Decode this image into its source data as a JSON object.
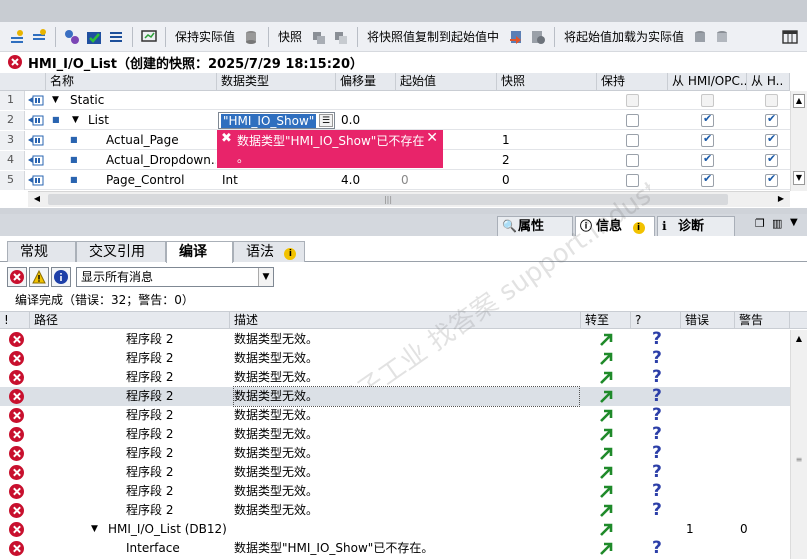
{
  "toolbar": {
    "keep_actual_label": "保持实际值",
    "snapshot_label": "快照",
    "copy_snapshot_label": "将快照值复制到起始值中",
    "load_start_label": "将起始值加载为实际值"
  },
  "block_title": "HMI_I/O_List（创建的快照：2025/7/29 18:15:20）",
  "table": {
    "headers": [
      "名称",
      "数据类型",
      "偏移量",
      "起始值",
      "快照",
      "保持",
      "从 HMI/OPC..",
      "从 H.."
    ],
    "rows": [
      {
        "num": "1",
        "name": "Static",
        "type": "",
        "offset": "",
        "start": "",
        "snapshot": ""
      },
      {
        "num": "2",
        "name": "List",
        "type": "\"HMI_IO_Show\"",
        "offset": "0.0",
        "start": "",
        "snapshot": ""
      },
      {
        "num": "3",
        "name": "Actual_Page",
        "type": "",
        "offset": "",
        "start": "",
        "snapshot": "1"
      },
      {
        "num": "4",
        "name": "Actual_Dropdown...",
        "type": "",
        "offset": "",
        "start": "",
        "snapshot": "2"
      },
      {
        "num": "5",
        "name": "Page_Control",
        "type": "Int",
        "offset": "4.0",
        "start": "0",
        "snapshot": "0"
      }
    ],
    "error_popup": "数据类型\"HMI_IO_Show\"已不存在\n。"
  },
  "inspector": {
    "tab_properties": "属性",
    "tab_info": "信息",
    "tab_diagnostics": "诊断"
  },
  "subtabs": [
    "常规",
    "交叉引用",
    "编译",
    "语法"
  ],
  "filter": {
    "selected": "显示所有消息"
  },
  "compile_summary": "编译完成（错误：32；警告：0）",
  "messages": {
    "headers": [
      "!",
      "路径",
      "描述",
      "转至",
      "?",
      "错误",
      "警告"
    ],
    "rows": [
      {
        "path": "程序段 2",
        "desc": "数据类型无效。",
        "errors": "",
        "warnings": ""
      },
      {
        "path": "程序段 2",
        "desc": "数据类型无效。",
        "errors": "",
        "warnings": ""
      },
      {
        "path": "程序段 2",
        "desc": "数据类型无效。",
        "errors": "",
        "warnings": ""
      },
      {
        "path": "程序段 2",
        "desc": "数据类型无效。",
        "errors": "",
        "warnings": ""
      },
      {
        "path": "程序段 2",
        "desc": "数据类型无效。",
        "errors": "",
        "warnings": ""
      },
      {
        "path": "程序段 2",
        "desc": "数据类型无效。",
        "errors": "",
        "warnings": ""
      },
      {
        "path": "程序段 2",
        "desc": "数据类型无效。",
        "errors": "",
        "warnings": ""
      },
      {
        "path": "程序段 2",
        "desc": "数据类型无效。",
        "errors": "",
        "warnings": ""
      },
      {
        "path": "程序段 2",
        "desc": "数据类型无效。",
        "errors": "",
        "warnings": ""
      },
      {
        "path": "程序段 2",
        "desc": "数据类型无效。",
        "errors": "",
        "warnings": ""
      },
      {
        "path": "HMI_I/O_List (DB12)",
        "desc": "",
        "errors": "1",
        "warnings": "0"
      },
      {
        "path": "Interface",
        "desc": "数据类型\"HMI_IO_Show\"已不存在。",
        "errors": "",
        "warnings": ""
      }
    ]
  },
  "watermark": "西门子工业 找答案 support.industry.siemens.com/cs"
}
